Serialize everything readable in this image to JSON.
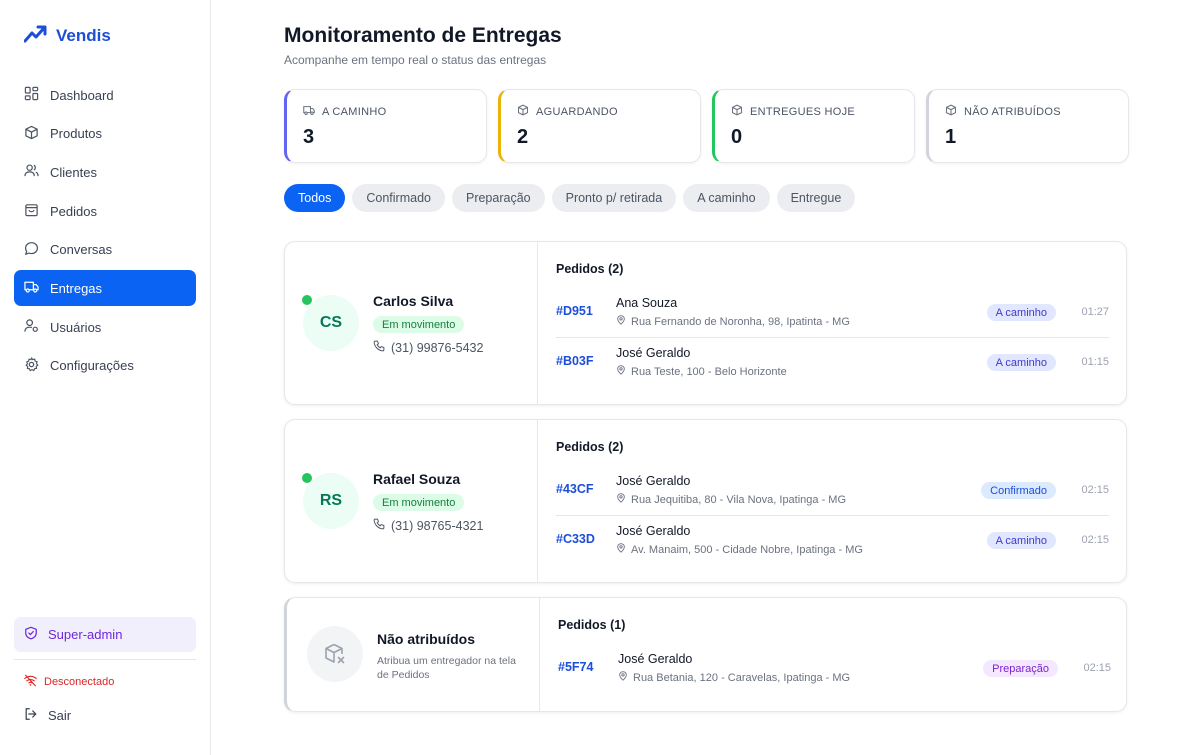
{
  "app": {
    "name": "Vendis"
  },
  "sidebar": {
    "items": [
      {
        "label": "Dashboard",
        "icon": "dashboard-icon"
      },
      {
        "label": "Produtos",
        "icon": "box-icon"
      },
      {
        "label": "Clientes",
        "icon": "users-icon"
      },
      {
        "label": "Pedidos",
        "icon": "bag-icon"
      },
      {
        "label": "Conversas",
        "icon": "chat-icon"
      },
      {
        "label": "Entregas",
        "icon": "truck-icon",
        "active": true
      },
      {
        "label": "Usuários",
        "icon": "user-cog-icon"
      },
      {
        "label": "Configurações",
        "icon": "gear-icon"
      }
    ],
    "role": "Super-admin",
    "connection_status": "Desconectado",
    "logout_label": "Sair"
  },
  "header": {
    "title": "Monitoramento de Entregas",
    "subtitle": "Acompanhe em tempo real o status das entregas"
  },
  "stats": [
    {
      "label": "A CAMINHO",
      "value": "3",
      "accent": "#6366f1",
      "icon": "truck-icon"
    },
    {
      "label": "AGUARDANDO",
      "value": "2",
      "accent": "#eab308",
      "icon": "box-icon"
    },
    {
      "label": "ENTREGUES HOJE",
      "value": "0",
      "accent": "#22c55e",
      "icon": "box-icon"
    },
    {
      "label": "NÃO ATRIBUÍDOS",
      "value": "1",
      "accent": "#d1d5db",
      "icon": "box-icon"
    }
  ],
  "filters": [
    "Todos",
    "Confirmado",
    "Preparação",
    "Pronto p/ retirada",
    "A caminho",
    "Entregue"
  ],
  "active_filter": "Todos",
  "couriers": [
    {
      "initials": "CS",
      "name": "Carlos Silva",
      "status": "Em movimento",
      "phone": "(31) 99876-5432",
      "orders_title": "Pedidos (2)",
      "orders": [
        {
          "code": "#D951",
          "customer": "Ana Souza",
          "address": "Rua Fernando de Noronha, 98, Ipatinta - MG",
          "status": "A caminho",
          "time": "01:27"
        },
        {
          "code": "#B03F",
          "customer": "José Geraldo",
          "address": "Rua Teste, 100 - Belo Horizonte",
          "status": "A caminho",
          "time": "01:15"
        }
      ]
    },
    {
      "initials": "RS",
      "name": "Rafael Souza",
      "status": "Em movimento",
      "phone": "(31) 98765-4321",
      "orders_title": "Pedidos (2)",
      "orders": [
        {
          "code": "#43CF",
          "customer": "José Geraldo",
          "address": "Rua Jequitiba, 80 - Vila Nova, Ipatinga - MG",
          "status": "Confirmado",
          "time": "02:15"
        },
        {
          "code": "#C33D",
          "customer": "José Geraldo",
          "address": "Av. Manaim, 500 - Cidade Nobre, Ipatinga - MG",
          "status": "A caminho",
          "time": "02:15"
        }
      ]
    }
  ],
  "unassigned": {
    "title": "Não atribuídos",
    "subtitle": "Atribua um entregador na tela de Pedidos",
    "orders_title": "Pedidos (1)",
    "orders": [
      {
        "code": "#5F74",
        "customer": "José Geraldo",
        "address": "Rua Betania, 120 - Caravelas, Ipatinga - MG",
        "status": "Preparação",
        "time": "02:15"
      }
    ]
  },
  "colors": {
    "primary": "#0b63f3",
    "online": "#22c55e",
    "disconnected": "#dc2626",
    "super_admin": "#6d28d9"
  }
}
